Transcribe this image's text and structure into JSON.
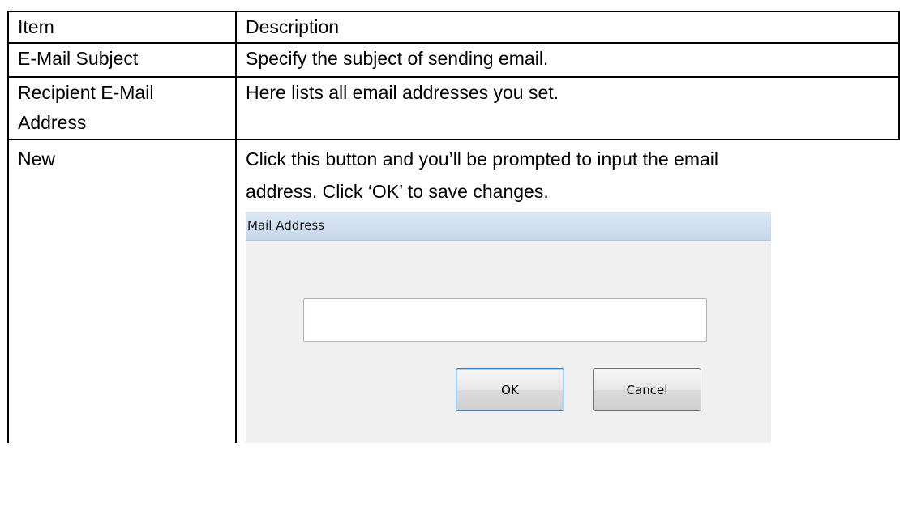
{
  "table": {
    "header": {
      "item": "Item",
      "description": "Description"
    },
    "rows": [
      {
        "item": "E-Mail Subject",
        "description": "Specify the subject of sending email."
      },
      {
        "item_line1": "Recipient E-Mail",
        "item_line2": "Address",
        "description": "Here lists all email addresses you set."
      },
      {
        "item": "New",
        "description_line1": "Click this button and you’ll be prompted to input the email",
        "description_line2": "address. Click ‘OK’ to save changes."
      }
    ]
  },
  "dialog": {
    "title": "Mail Address",
    "input_value": "",
    "ok_label": "OK",
    "cancel_label": "Cancel"
  }
}
